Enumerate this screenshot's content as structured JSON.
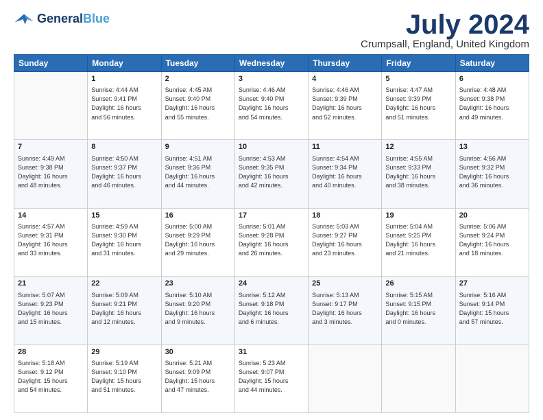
{
  "header": {
    "logo_line1": "General",
    "logo_line2": "Blue",
    "month": "July 2024",
    "location": "Crumpsall, England, United Kingdom"
  },
  "weekdays": [
    "Sunday",
    "Monday",
    "Tuesday",
    "Wednesday",
    "Thursday",
    "Friday",
    "Saturday"
  ],
  "weeks": [
    [
      {
        "day": "",
        "info": ""
      },
      {
        "day": "1",
        "info": "Sunrise: 4:44 AM\nSunset: 9:41 PM\nDaylight: 16 hours\nand 56 minutes."
      },
      {
        "day": "2",
        "info": "Sunrise: 4:45 AM\nSunset: 9:40 PM\nDaylight: 16 hours\nand 55 minutes."
      },
      {
        "day": "3",
        "info": "Sunrise: 4:46 AM\nSunset: 9:40 PM\nDaylight: 16 hours\nand 54 minutes."
      },
      {
        "day": "4",
        "info": "Sunrise: 4:46 AM\nSunset: 9:39 PM\nDaylight: 16 hours\nand 52 minutes."
      },
      {
        "day": "5",
        "info": "Sunrise: 4:47 AM\nSunset: 9:39 PM\nDaylight: 16 hours\nand 51 minutes."
      },
      {
        "day": "6",
        "info": "Sunrise: 4:48 AM\nSunset: 9:38 PM\nDaylight: 16 hours\nand 49 minutes."
      }
    ],
    [
      {
        "day": "7",
        "info": "Sunrise: 4:49 AM\nSunset: 9:38 PM\nDaylight: 16 hours\nand 48 minutes."
      },
      {
        "day": "8",
        "info": "Sunrise: 4:50 AM\nSunset: 9:37 PM\nDaylight: 16 hours\nand 46 minutes."
      },
      {
        "day": "9",
        "info": "Sunrise: 4:51 AM\nSunset: 9:36 PM\nDaylight: 16 hours\nand 44 minutes."
      },
      {
        "day": "10",
        "info": "Sunrise: 4:53 AM\nSunset: 9:35 PM\nDaylight: 16 hours\nand 42 minutes."
      },
      {
        "day": "11",
        "info": "Sunrise: 4:54 AM\nSunset: 9:34 PM\nDaylight: 16 hours\nand 40 minutes."
      },
      {
        "day": "12",
        "info": "Sunrise: 4:55 AM\nSunset: 9:33 PM\nDaylight: 16 hours\nand 38 minutes."
      },
      {
        "day": "13",
        "info": "Sunrise: 4:56 AM\nSunset: 9:32 PM\nDaylight: 16 hours\nand 36 minutes."
      }
    ],
    [
      {
        "day": "14",
        "info": "Sunrise: 4:57 AM\nSunset: 9:31 PM\nDaylight: 16 hours\nand 33 minutes."
      },
      {
        "day": "15",
        "info": "Sunrise: 4:59 AM\nSunset: 9:30 PM\nDaylight: 16 hours\nand 31 minutes."
      },
      {
        "day": "16",
        "info": "Sunrise: 5:00 AM\nSunset: 9:29 PM\nDaylight: 16 hours\nand 29 minutes."
      },
      {
        "day": "17",
        "info": "Sunrise: 5:01 AM\nSunset: 9:28 PM\nDaylight: 16 hours\nand 26 minutes."
      },
      {
        "day": "18",
        "info": "Sunrise: 5:03 AM\nSunset: 9:27 PM\nDaylight: 16 hours\nand 23 minutes."
      },
      {
        "day": "19",
        "info": "Sunrise: 5:04 AM\nSunset: 9:25 PM\nDaylight: 16 hours\nand 21 minutes."
      },
      {
        "day": "20",
        "info": "Sunrise: 5:06 AM\nSunset: 9:24 PM\nDaylight: 16 hours\nand 18 minutes."
      }
    ],
    [
      {
        "day": "21",
        "info": "Sunrise: 5:07 AM\nSunset: 9:23 PM\nDaylight: 16 hours\nand 15 minutes."
      },
      {
        "day": "22",
        "info": "Sunrise: 5:09 AM\nSunset: 9:21 PM\nDaylight: 16 hours\nand 12 minutes."
      },
      {
        "day": "23",
        "info": "Sunrise: 5:10 AM\nSunset: 9:20 PM\nDaylight: 16 hours\nand 9 minutes."
      },
      {
        "day": "24",
        "info": "Sunrise: 5:12 AM\nSunset: 9:18 PM\nDaylight: 16 hours\nand 6 minutes."
      },
      {
        "day": "25",
        "info": "Sunrise: 5:13 AM\nSunset: 9:17 PM\nDaylight: 16 hours\nand 3 minutes."
      },
      {
        "day": "26",
        "info": "Sunrise: 5:15 AM\nSunset: 9:15 PM\nDaylight: 16 hours\nand 0 minutes."
      },
      {
        "day": "27",
        "info": "Sunrise: 5:16 AM\nSunset: 9:14 PM\nDaylight: 15 hours\nand 57 minutes."
      }
    ],
    [
      {
        "day": "28",
        "info": "Sunrise: 5:18 AM\nSunset: 9:12 PM\nDaylight: 15 hours\nand 54 minutes."
      },
      {
        "day": "29",
        "info": "Sunrise: 5:19 AM\nSunset: 9:10 PM\nDaylight: 15 hours\nand 51 minutes."
      },
      {
        "day": "30",
        "info": "Sunrise: 5:21 AM\nSunset: 9:09 PM\nDaylight: 15 hours\nand 47 minutes."
      },
      {
        "day": "31",
        "info": "Sunrise: 5:23 AM\nSunset: 9:07 PM\nDaylight: 15 hours\nand 44 minutes."
      },
      {
        "day": "",
        "info": ""
      },
      {
        "day": "",
        "info": ""
      },
      {
        "day": "",
        "info": ""
      }
    ]
  ]
}
